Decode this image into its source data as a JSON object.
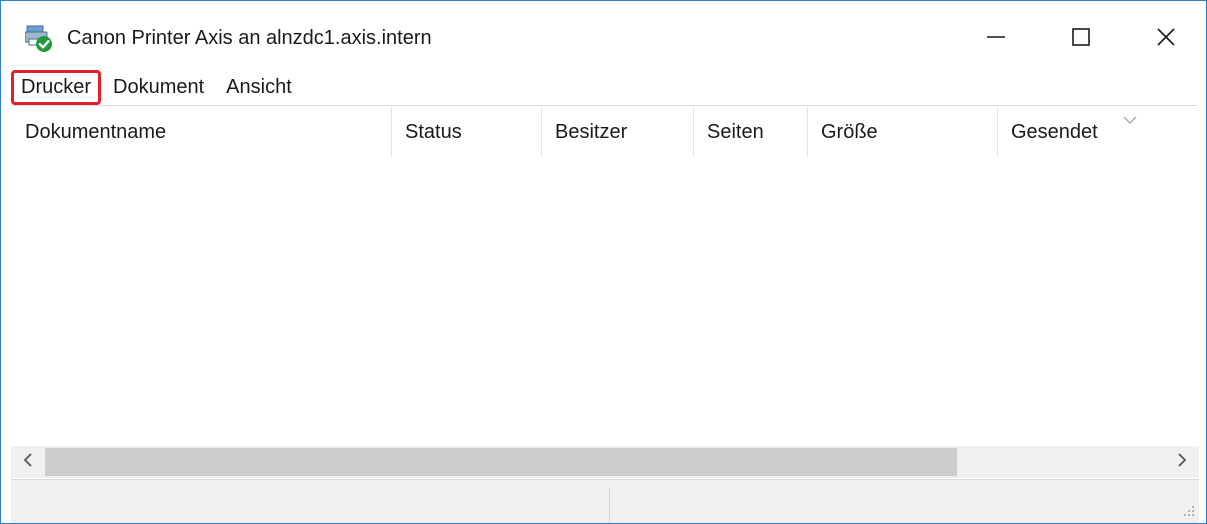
{
  "window": {
    "title": "Canon Printer Axis an alnzdc1.axis.intern",
    "icon": "printer-queue-icon",
    "controls": {
      "minimize": "minimize-icon",
      "maximize": "maximize-icon",
      "close": "close-icon"
    }
  },
  "menu": {
    "items": [
      {
        "label": "Drucker",
        "highlighted": true
      },
      {
        "label": "Dokument",
        "highlighted": false
      },
      {
        "label": "Ansicht",
        "highlighted": false
      }
    ]
  },
  "list": {
    "columns": [
      {
        "label": "Dokumentname"
      },
      {
        "label": "Status"
      },
      {
        "label": "Besitzer"
      },
      {
        "label": "Seiten"
      },
      {
        "label": "Größe"
      },
      {
        "label": "Gesendet"
      }
    ],
    "rows": []
  },
  "statusbar": {
    "left": "",
    "right": ""
  },
  "colors": {
    "window_border": "#2b7fd4",
    "highlight_outline": "#e0202a",
    "chrome_background": "#f0f0f0",
    "scroll_thumb": "#cdcdcd"
  }
}
